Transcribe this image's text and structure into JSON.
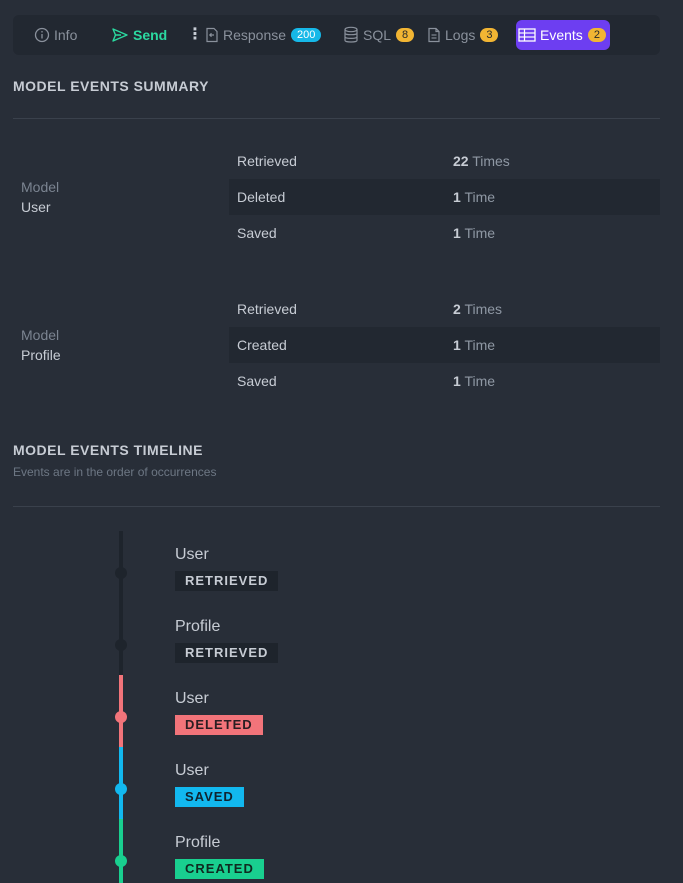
{
  "tabs": {
    "info": "Info",
    "send": "Send",
    "response": "Response",
    "response_badge": "200",
    "sql": "SQL",
    "sql_badge": "8",
    "logs": "Logs",
    "logs_badge": "3",
    "events": "Events",
    "events_badge": "2"
  },
  "summary": {
    "title": "MODEL EVENTS SUMMARY",
    "model_label": "Model",
    "models": [
      {
        "name": "User",
        "events": [
          {
            "event": "Retrieved",
            "count": "22",
            "unit": "Times"
          },
          {
            "event": "Deleted",
            "count": "1",
            "unit": "Time"
          },
          {
            "event": "Saved",
            "count": "1",
            "unit": "Time"
          }
        ]
      },
      {
        "name": "Profile",
        "events": [
          {
            "event": "Retrieved",
            "count": "2",
            "unit": "Times"
          },
          {
            "event": "Created",
            "count": "1",
            "unit": "Time"
          },
          {
            "event": "Saved",
            "count": "1",
            "unit": "Time"
          }
        ]
      }
    ]
  },
  "timeline": {
    "title": "MODEL EVENTS TIMELINE",
    "subtitle": "Events are in the order of occurrences",
    "items": [
      {
        "model": "User",
        "event": "RETRIEVED",
        "color": "#1e242c"
      },
      {
        "model": "Profile",
        "event": "RETRIEVED",
        "color": "#1e242c"
      },
      {
        "model": "User",
        "event": "DELETED",
        "color": "#f2747a"
      },
      {
        "model": "User",
        "event": "SAVED",
        "color": "#12b8ef"
      },
      {
        "model": "Profile",
        "event": "CREATED",
        "color": "#19cf8f"
      }
    ]
  },
  "colors": {
    "accent_send": "#2bd9a0",
    "accent_events": "#6d3ef1",
    "badge_cyan": "#16b8e8",
    "badge_amber": "#f2b533"
  }
}
